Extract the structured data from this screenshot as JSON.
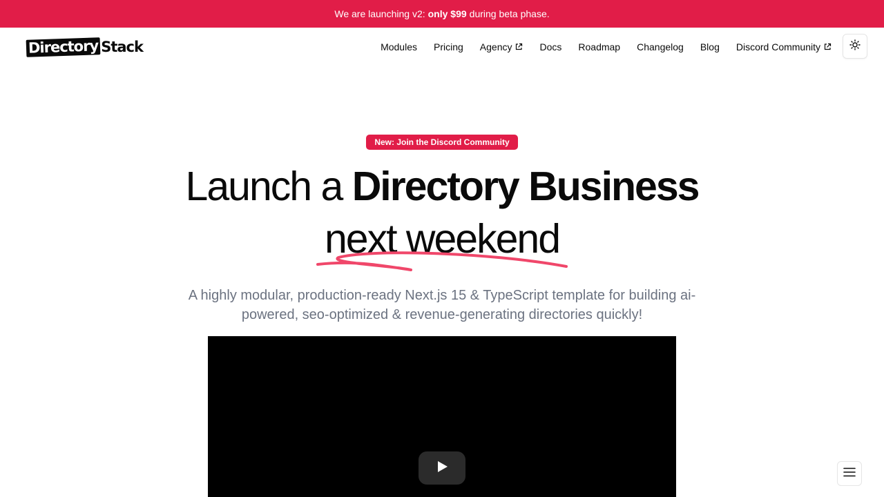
{
  "banner": {
    "prefix": "We are launching v2:",
    "highlight": "only $99",
    "suffix": "during beta phase."
  },
  "logo": {
    "part1": "Directory",
    "part2": "Stack"
  },
  "nav": {
    "items": [
      {
        "label": "Modules",
        "external": false
      },
      {
        "label": "Pricing",
        "external": false
      },
      {
        "label": "Agency",
        "external": true
      },
      {
        "label": "Docs",
        "external": false
      },
      {
        "label": "Roadmap",
        "external": false
      },
      {
        "label": "Changelog",
        "external": false
      },
      {
        "label": "Blog",
        "external": false
      },
      {
        "label": "Discord Community",
        "external": true
      }
    ],
    "theme_icon": "sun-icon"
  },
  "hero": {
    "pill": "New: Join the Discord Community",
    "headline_light": "Launch a",
    "headline_bold": "Directory Business",
    "headline_line2": "next weekend",
    "subtitle": "A highly modular, production-ready Next.js 15 & TypeScript template for building ai-powered, seo-optimized & revenue-generating directories quickly!"
  },
  "video": {
    "play_icon": "play-icon"
  },
  "menu": {
    "icon": "hamburger-menu-icon"
  },
  "colors": {
    "accent": "#e11d48",
    "text": "#0a0a0a",
    "muted": "#6b7280",
    "underline": "#f0476a"
  }
}
